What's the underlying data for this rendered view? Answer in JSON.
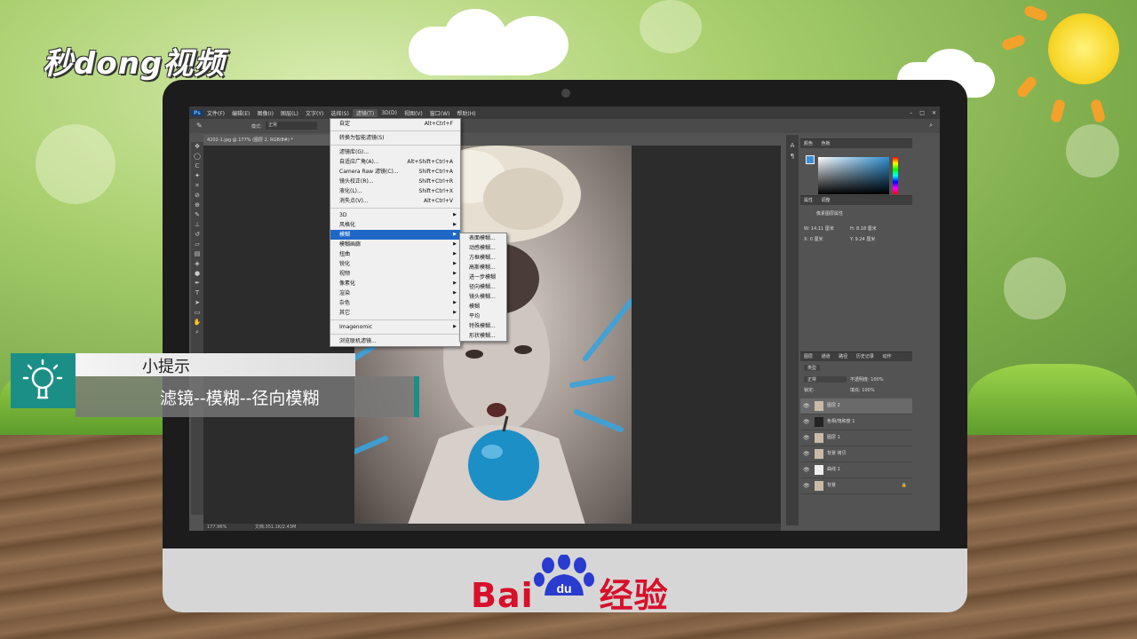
{
  "branding": {
    "top_left_logo": "秒dong视频",
    "bottom_brand": "Bai",
    "bottom_brand_paw": "du",
    "bottom_brand_suffix": "经验"
  },
  "photoshop": {
    "menubar": [
      "文件(F)",
      "编辑(E)",
      "图像(I)",
      "图层(L)",
      "文字(Y)",
      "选择(S)",
      "滤镜(T)",
      "3D(D)",
      "视图(V)",
      "窗口(W)",
      "帮助(H)"
    ],
    "active_menu_index": 6,
    "options": {
      "mode_label": "模式:",
      "mode_value": "正常"
    },
    "doc_tab": "4202-1.jpg @ 177% (图层 2, RGB/8#) *",
    "status_zoom": "177.96%",
    "status_doc": "文档:351.1K/2.43M",
    "filter_menu": {
      "top_items": [
        {
          "label": "自定",
          "shortcut": "Alt+Ctrl+F"
        }
      ],
      "smart": "转换为智能滤镜(S)",
      "group2": [
        {
          "label": "滤镜库(G)...",
          "shortcut": ""
        },
        {
          "label": "自适应广角(A)...",
          "shortcut": "Alt+Shift+Ctrl+A"
        },
        {
          "label": "Camera Raw 滤镜(C)...",
          "shortcut": "Shift+Ctrl+A"
        },
        {
          "label": "镜头校正(R)...",
          "shortcut": "Shift+Ctrl+R"
        },
        {
          "label": "液化(L)...",
          "shortcut": "Shift+Ctrl+X"
        },
        {
          "label": "消失点(V)...",
          "shortcut": "Alt+Ctrl+V"
        }
      ],
      "submenus": [
        "3D",
        "风格化",
        "模糊",
        "模糊画廊",
        "扭曲",
        "锐化",
        "视频",
        "像素化",
        "渲染",
        "杂色",
        "其它"
      ],
      "highlighted_submenu": "模糊",
      "plugin": "Imagenomic",
      "browse": "浏览联机滤镜..."
    },
    "blur_submenu": [
      "表面模糊...",
      "动感模糊...",
      "方框模糊...",
      "高斯模糊...",
      "进一步模糊",
      "径向模糊...",
      "镜头模糊...",
      "模糊",
      "平均",
      "特殊模糊...",
      "形状模糊..."
    ],
    "color_panel_tabs": [
      "颜色",
      "色板"
    ],
    "properties_panel_tabs": [
      "属性",
      "调整"
    ],
    "properties_title": "像素图层属性",
    "properties_fields": {
      "w": "W: 14.11 厘米",
      "h": "H: 8.18 厘米",
      "x": "X: 0 厘米",
      "y": "Y: 9.24 厘米"
    },
    "layers_panel_tabs": [
      "图层",
      "通道",
      "路径",
      "历史记录",
      "动作"
    ],
    "layers_kind": "类型",
    "layers_blend": "正常",
    "layers_opacity": "不透明度: 100%",
    "layers_fill": "填充: 100%",
    "layers_lock": "锁定:",
    "layers": [
      {
        "name": "图层 2",
        "selected": true
      },
      {
        "name": "色相/饱和度 1",
        "selected": false
      },
      {
        "name": "图层 1",
        "selected": false
      },
      {
        "name": "背景 拷贝",
        "selected": false
      },
      {
        "name": "曲线 1",
        "selected": false
      },
      {
        "name": "背景",
        "selected": false
      }
    ]
  },
  "tip": {
    "title": "小提示",
    "text": "滤镜--模糊--径向模糊"
  }
}
